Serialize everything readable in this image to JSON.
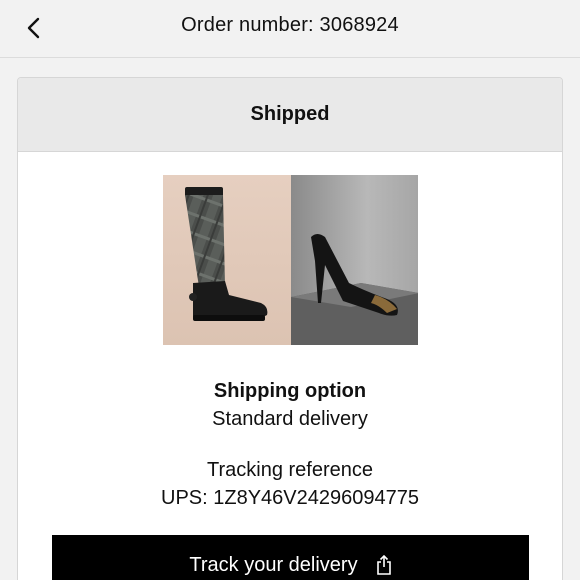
{
  "header": {
    "back_icon": "chevron-left-icon",
    "title": "Order number: 3068924"
  },
  "order": {
    "status": "Shipped",
    "shipping_option_title": "Shipping option",
    "shipping_option_value": "Standard delivery",
    "tracking_label": "Tracking reference",
    "tracking_value": "UPS: 1Z8Y46V24296094775"
  },
  "actions": {
    "track_label": "Track your delivery",
    "track_icon": "share-external-icon"
  },
  "products": [
    {
      "name": "boot",
      "background": "#e2c9b9"
    },
    {
      "name": "heel",
      "background": "#9b9b9b"
    }
  ]
}
